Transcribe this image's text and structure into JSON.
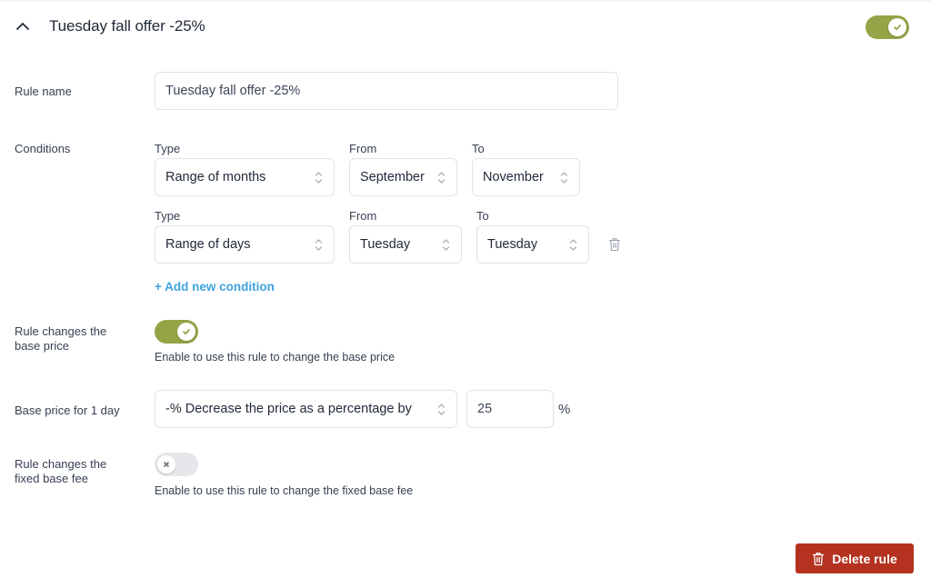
{
  "header": {
    "title": "Tuesday fall offer -25%",
    "collapse_icon": "chevron-up-icon",
    "rule_enabled": true,
    "accent_color": "#94a447"
  },
  "rule_name": {
    "label": "Rule name",
    "value": "Tuesday fall offer -25%"
  },
  "conditions": {
    "label": "Conditions",
    "rows": [
      {
        "type_label": "Type",
        "type_value": "Range of months",
        "from_label": "From",
        "from_value": "September",
        "to_label": "To",
        "to_value": "November",
        "deletable": false
      },
      {
        "type_label": "Type",
        "type_value": "Range of days",
        "from_label": "From",
        "from_value": "Tuesday",
        "to_label": "To",
        "to_value": "Tuesday",
        "deletable": true,
        "delete_icon": "trash-icon"
      }
    ],
    "add_label": "+ Add new condition",
    "link_color": "#3fa2e0"
  },
  "base_price_toggle": {
    "label": "Rule changes the base price",
    "enabled": true,
    "hint": "Enable to use this rule to change the base price"
  },
  "base_price": {
    "label": "Base price for 1 day",
    "mode_value": "-% Decrease the price as a percentage by",
    "amount_value": "25",
    "unit": "%"
  },
  "fixed_fee_toggle": {
    "label": "Rule changes the fixed base fee",
    "enabled": false,
    "hint": "Enable to use this rule to change the fixed base fee"
  },
  "actions": {
    "delete_label": "Delete rule",
    "delete_icon": "trash-icon",
    "danger_color": "#b4321f"
  }
}
